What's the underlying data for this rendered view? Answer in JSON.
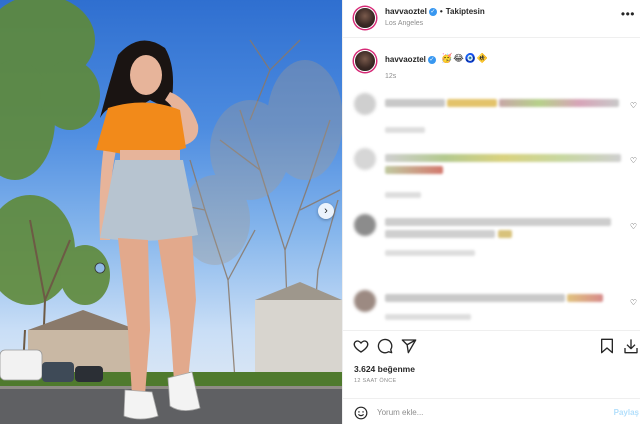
{
  "post": {
    "username": "havvaoztel",
    "follow_status": "Takiptesin",
    "location": "Los Angeles",
    "more_label": "•••",
    "caption_emojis": "🥳😂🧿🚸",
    "caption_time": "12s",
    "likes": "3.624 beğenme",
    "time_ago": "12 SAAT ÖNCE",
    "comment_placeholder": "Yorum ekle...",
    "post_button": "Paylaş"
  },
  "comments": [
    {
      "blurred": true
    },
    {
      "blurred": true
    },
    {
      "blurred": true
    },
    {
      "blurred": true
    }
  ],
  "colors": {
    "verified_badge": "#3897f0",
    "story_ring": "#d62976",
    "post_button_disabled": "#b2dffc",
    "top_shirt": "#f28a1a",
    "skirt": "#b7c4d0"
  },
  "icons": [
    "heart-icon",
    "comment-icon",
    "share-icon",
    "bookmark-icon",
    "smile-icon",
    "chevron-right-icon",
    "verified-icon"
  ]
}
